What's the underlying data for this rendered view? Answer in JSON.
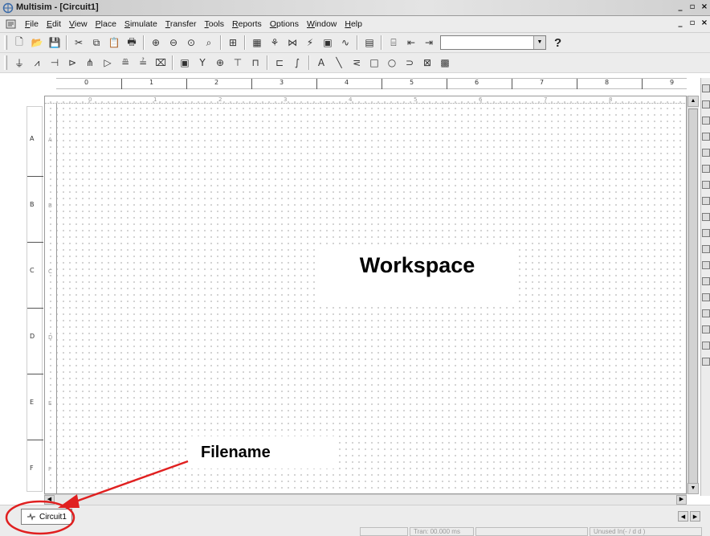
{
  "window": {
    "title": "Multisim - [Circuit1]"
  },
  "menu": {
    "items": [
      {
        "key": "F",
        "rest": "ile"
      },
      {
        "key": "E",
        "rest": "dit"
      },
      {
        "key": "V",
        "rest": "iew"
      },
      {
        "key": "P",
        "rest": "lace"
      },
      {
        "key": "S",
        "rest": "imulate"
      },
      {
        "key": "T",
        "rest": "ransfer"
      },
      {
        "key": "T",
        "rest": "ools"
      },
      {
        "key": "R",
        "rest": "eports"
      },
      {
        "key": "O",
        "rest": "ptions"
      },
      {
        "key": "W",
        "rest": "indow"
      },
      {
        "key": "H",
        "rest": "elp"
      }
    ]
  },
  "toolbar1": {
    "buttons": [
      "new-icon",
      "open-icon",
      "save-icon",
      "|",
      "cut-icon",
      "copy-icon",
      "paste-icon",
      "print-icon",
      "|",
      "zoom-in-icon",
      "zoom-out-icon",
      "zoom-area-icon",
      "zoom-fit-icon",
      "|",
      "grid-icon",
      "|",
      "table-icon",
      "analysis-icon",
      "postprocessor-icon",
      "flash-icon",
      "instrument-icon",
      "wave-icon",
      "|",
      "chip-icon",
      "|",
      "database-icon",
      "back-annotate-icon",
      "forward-annotate-icon"
    ],
    "glyphs": {
      "new-icon": "🗋",
      "open-icon": "📂",
      "save-icon": "💾",
      "cut-icon": "✂",
      "copy-icon": "⧉",
      "paste-icon": "📋",
      "print-icon": "🖶",
      "zoom-in-icon": "⊕",
      "zoom-out-icon": "⊖",
      "zoom-area-icon": "⊙",
      "zoom-fit-icon": "⌕",
      "grid-icon": "⊞",
      "table-icon": "▦",
      "analysis-icon": "⚘",
      "postprocessor-icon": "⋈",
      "flash-icon": "⚡",
      "instrument-icon": "▣",
      "wave-icon": "∿",
      "chip-icon": "▤",
      "database-icon": "⌸",
      "back-annotate-icon": "⇤",
      "forward-annotate-icon": "⇥"
    },
    "combo_value": "",
    "help_label": "?"
  },
  "toolbar2": {
    "buttons": [
      "source-icon",
      "resistor-icon",
      "capacitor-icon",
      "diode-icon",
      "transistor-icon",
      "analog-icon",
      "ttl-icon",
      "cmos-icon",
      "digital-icon",
      "|",
      "misc-icon",
      "indicator-icon",
      "mixed-icon",
      "rf-icon",
      "electromech-icon",
      "|",
      "ladder-icon",
      "bus-icon",
      "|",
      "text-icon",
      "line-icon",
      "multiline-icon",
      "rectangle-icon",
      "ellipse-icon",
      "arc-icon",
      "polygon-icon",
      "picture-icon"
    ],
    "glyphs": {
      "source-icon": "⏚",
      "resistor-icon": "⩘",
      "capacitor-icon": "⊣",
      "diode-icon": "⊳",
      "transistor-icon": "⋔",
      "analog-icon": "▷",
      "ttl-icon": "≞",
      "cmos-icon": "≟",
      "digital-icon": "⌧",
      "misc-icon": "▣",
      "indicator-icon": "Y",
      "mixed-icon": "⊕",
      "rf-icon": "⊤",
      "electromech-icon": "⊓",
      "ladder-icon": "⊏",
      "bus-icon": "∫",
      "text-icon": "A",
      "line-icon": "╲",
      "multiline-icon": "⋜",
      "rectangle-icon": "□",
      "ellipse-icon": "○",
      "arc-icon": "⊃",
      "polygon-icon": "⊠",
      "picture-icon": "▩"
    }
  },
  "ruler": {
    "columns": [
      "0",
      "1",
      "2",
      "3",
      "4",
      "5",
      "6",
      "7",
      "8",
      "9"
    ],
    "rows": [
      "A",
      "B",
      "C",
      "D",
      "E",
      "F"
    ]
  },
  "workspace": {
    "inner_columns": [
      "0",
      "1",
      "2",
      "3",
      "4",
      "5",
      "6",
      "7",
      "8"
    ],
    "inner_rows": [
      "A",
      "B",
      "C",
      "D",
      "E",
      "F"
    ]
  },
  "tabs": [
    {
      "label": "Circuit1"
    }
  ],
  "status": {
    "cells": [
      "",
      "Tran: 00.000 ms",
      "",
      "Unused In(- / d d )"
    ]
  },
  "annotations": {
    "workspace_label": "Workspace",
    "filename_label": "Filename",
    "circle_color": "#e02020",
    "arrow_color": "#e02020"
  }
}
